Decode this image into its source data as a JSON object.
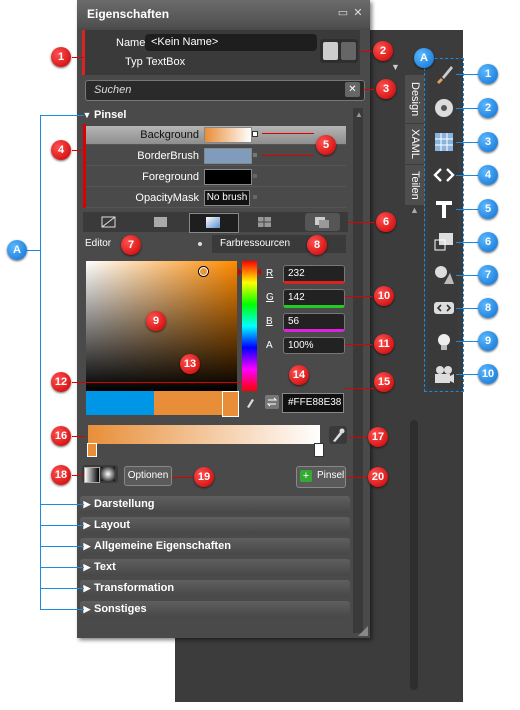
{
  "panel": {
    "title": "Eigenschaften",
    "name_label": "Name",
    "name_value": "<Kein Name>",
    "type_label": "Typ",
    "type_value": "TextBox",
    "search_placeholder": "Suchen"
  },
  "brush_section": {
    "title": "Pinsel",
    "properties": [
      {
        "label": "Background",
        "value": ""
      },
      {
        "label": "BorderBrush",
        "value": ""
      },
      {
        "label": "Foreground",
        "value": ""
      },
      {
        "label": "OpacityMask",
        "value": "No brush"
      }
    ],
    "editor_tab": "Editor",
    "resources_tab": "Farbressourcen",
    "channels": [
      {
        "name": "R",
        "value": "232"
      },
      {
        "name": "G",
        "value": "142"
      },
      {
        "name": "B",
        "value": "56"
      },
      {
        "name": "A",
        "value": "100%"
      }
    ],
    "hex_value": "#FFE88E38",
    "options_button": "Optionen",
    "brush_button": "Pinsel"
  },
  "collapsed_sections": [
    "Darstellung",
    "Layout",
    "Allgemeine Eigenschaften",
    "Text",
    "Transformation",
    "Sonstiges"
  ],
  "side_tabs": [
    "Design",
    "XAML",
    "Teilen"
  ],
  "callouts_red": [
    "1",
    "2",
    "3",
    "4",
    "5",
    "6",
    "7",
    "8",
    "9",
    "10",
    "11",
    "12",
    "13",
    "14",
    "15",
    "16",
    "17",
    "18",
    "19",
    "20"
  ],
  "callouts_blue": [
    "A",
    "A",
    "1",
    "2",
    "3",
    "4",
    "5",
    "6",
    "7",
    "8",
    "9",
    "10"
  ],
  "colors": {
    "accent_red": "#d00000",
    "accent_blue": "#1a8be0",
    "selected_color": "#E88E38"
  },
  "icons": [
    "brush-icon",
    "disc-icon",
    "grid-icon",
    "code-brackets-icon",
    "text-t-icon",
    "rectangle-icon",
    "shapes-icon",
    "code-arrows-icon",
    "lightbulb-icon",
    "camera-icon",
    "close-icon",
    "eyedropper-icon",
    "swap-icon"
  ]
}
